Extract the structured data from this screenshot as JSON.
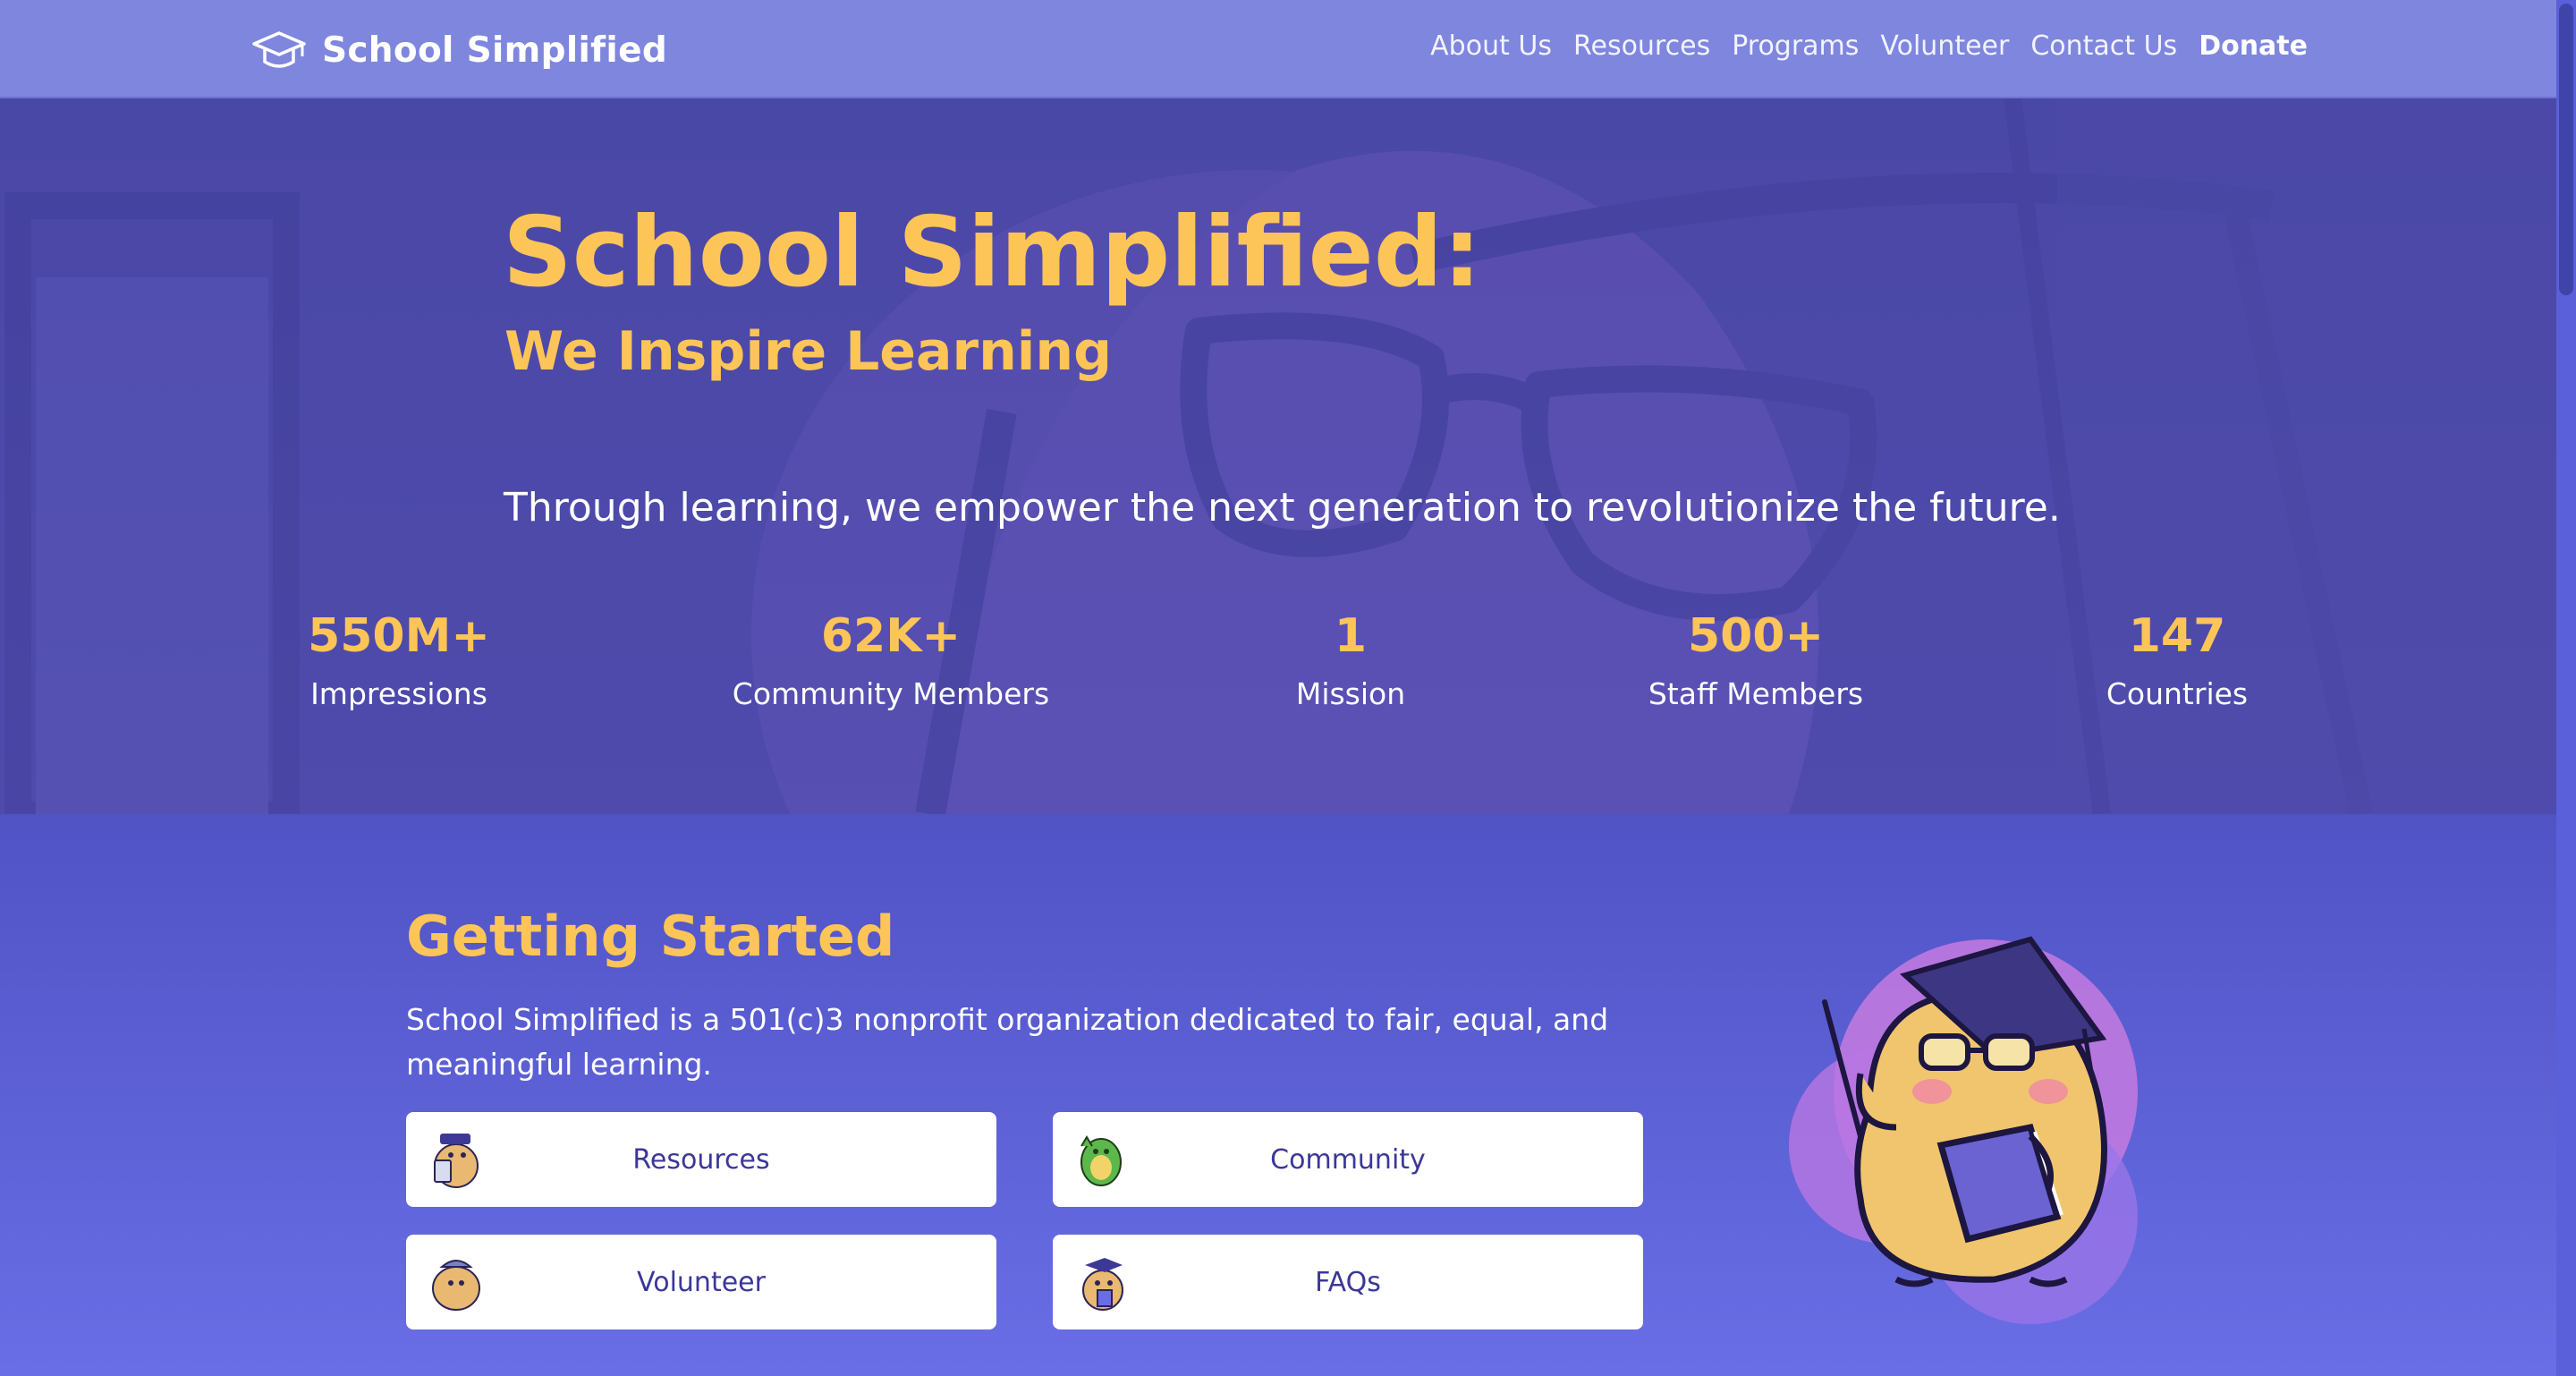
{
  "nav": {
    "brand": "School Simplified",
    "links": [
      "About Us",
      "Resources",
      "Programs",
      "Volunteer",
      "Contact Us",
      "Donate"
    ]
  },
  "hero": {
    "title": "School Simplified:",
    "subtitle": "We Inspire Learning",
    "tagline": "Through learning, we empower the next generation to revolutionize the future.",
    "stats": [
      {
        "value": "550M+",
        "label": "Impressions"
      },
      {
        "value": "62K+",
        "label": "Community Members"
      },
      {
        "value": "1",
        "label": "Mission"
      },
      {
        "value": "500+",
        "label": "Staff Members"
      },
      {
        "value": "147",
        "label": "Countries"
      }
    ]
  },
  "getting_started": {
    "title": "Getting Started",
    "description": "School Simplified is a 501(c)3 nonprofit organization dedicated to fair, equal, and meaningful learning.",
    "cards": [
      {
        "label": "Resources",
        "icon": "reading-mascot-icon"
      },
      {
        "label": "Community",
        "icon": "green-mascot-icon"
      },
      {
        "label": "Volunteer",
        "icon": "hat-mascot-icon"
      },
      {
        "label": "FAQs",
        "icon": "graduate-mascot-icon"
      }
    ]
  },
  "colors": {
    "accent": "#fdc458",
    "nav_bg": "#7f86de",
    "hero_bg": "#4c4aa9",
    "section_bg": "#5b5fd6",
    "card_text": "#3b3799"
  }
}
